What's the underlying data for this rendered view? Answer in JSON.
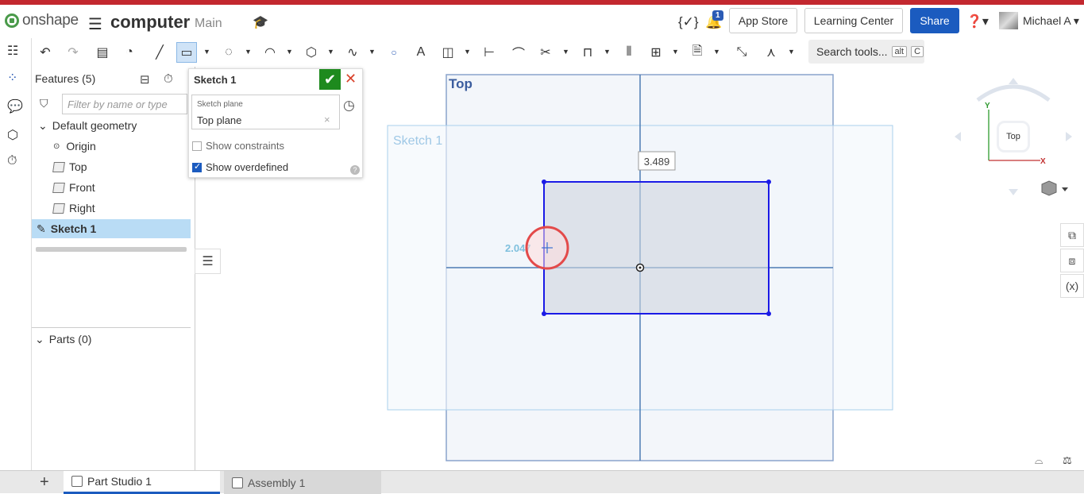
{
  "header": {
    "logo_text": "onshape",
    "doc_name": "computer",
    "branch": "Main",
    "notification_count": "1",
    "app_store": "App Store",
    "learning_center": "Learning Center",
    "share": "Share",
    "user_name": "Michael A"
  },
  "toolbar": {
    "search_label": "Search tools...",
    "search_keys": [
      "alt",
      "C"
    ]
  },
  "features": {
    "title": "Features (5)",
    "filter_placeholder": "Filter by name or type",
    "default_geometry": "Default geometry",
    "items": [
      "Origin",
      "Top",
      "Front",
      "Right"
    ],
    "sketch": "Sketch 1",
    "parts": "Parts (0)"
  },
  "sketch_panel": {
    "title": "Sketch 1",
    "plane_label": "Sketch plane",
    "plane_value": "Top plane",
    "show_constraints": "Show constraints",
    "show_overdefined": "Show overdefined",
    "show_constraints_checked": false,
    "show_overdefined_checked": true
  },
  "viewport": {
    "plane_label": "Top",
    "sketch_label": "Sketch 1",
    "dim_width": "3.489",
    "dim_height": "2.047",
    "view_cube_face": "Top",
    "axis_y": "Y",
    "axis_x": "X"
  },
  "tabs": {
    "part_studio": "Part Studio 1",
    "assembly": "Assembly 1"
  },
  "colors": {
    "accent": "#1b5bbf",
    "sketch_blue": "#1a1ae6",
    "confirm_green": "#1e8a1e",
    "cancel_red": "#d9432c"
  }
}
